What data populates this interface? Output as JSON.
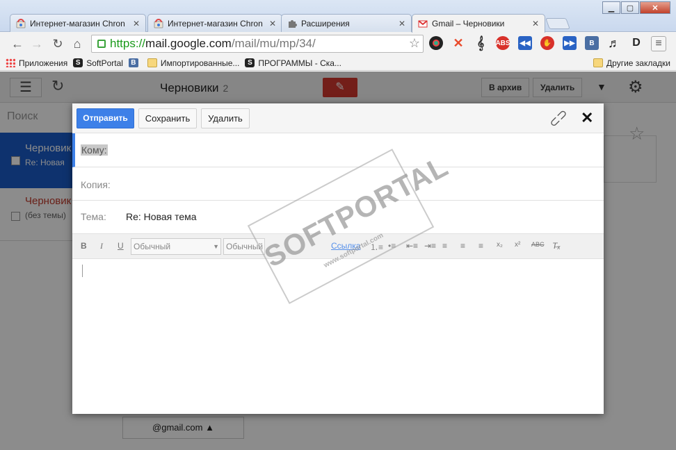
{
  "browser": {
    "tabs": [
      {
        "title": "Интернет-магазин Chron",
        "icon": "chrome-webstore-icon"
      },
      {
        "title": "Интернет-магазин Chron",
        "icon": "chrome-webstore-icon"
      },
      {
        "title": "Расширения",
        "icon": "puzzle-icon"
      },
      {
        "title": "Gmail – Черновики",
        "icon": "gmail-icon"
      }
    ],
    "url": {
      "scheme": "https://",
      "host": "mail.google.com",
      "path": "/mail/mu/mp/34/"
    },
    "bookmarks": [
      {
        "label": "Приложения",
        "icon": "apps-grid-icon"
      },
      {
        "label": "SoftPortal",
        "icon": "softportal-icon"
      },
      {
        "label": "",
        "icon": "vk-icon"
      },
      {
        "label": "Импортированные...",
        "icon": "folder-icon"
      },
      {
        "label": "ПРОГРАММЫ - Ска...",
        "icon": "softportal-icon"
      }
    ],
    "other_bookmarks": "Другие закладки",
    "extensions": [
      {
        "label": "",
        "icon": "camera-ext-icon",
        "color": "#222222"
      },
      {
        "label": "",
        "icon": "x-ext-icon",
        "color": "#e94b2c"
      },
      {
        "label": "",
        "icon": "treble-clef-icon",
        "color": "#333333"
      },
      {
        "label": "ABS",
        "icon": "adblock-icon",
        "color": "#d8312a"
      },
      {
        "label": "",
        "icon": "rewind-icon",
        "color": "#2a63c4"
      },
      {
        "label": "",
        "icon": "stop-hand-icon",
        "color": "#d8312a"
      },
      {
        "label": "",
        "icon": "forward-icon",
        "color": "#2a63c4"
      },
      {
        "label": "B",
        "icon": "vk-icon",
        "color": "#4a6ea3"
      },
      {
        "label": "",
        "icon": "music-note-icon",
        "color": "#222222"
      },
      {
        "label": "D",
        "icon": "d2-icon",
        "color": "#222222"
      }
    ]
  },
  "gmail": {
    "folder_title": "Черновики",
    "folder_count": "2",
    "archive_label": "В архив",
    "delete_label": "Удалить",
    "search_placeholder": "Поиск",
    "rows": [
      {
        "title": "Черновик",
        "snippet": "Re: Новая"
      },
      {
        "title": "Черновик",
        "snippet": "(без темы)"
      }
    ],
    "account": "@gmail.com ▲"
  },
  "compose": {
    "send_label": "Отправить",
    "save_label": "Сохранить",
    "delete_label": "Удалить",
    "to_label": "Кому:",
    "cc_label": "Копия:",
    "subject_label": "Тема:",
    "subject_value": "Re: Новая тема",
    "font_family": "Обычный",
    "font_size": "Обычный",
    "link_label": "Ссылка"
  },
  "watermark": {
    "text": "SOFTPORTAL",
    "sub": "www.softportal.com"
  }
}
